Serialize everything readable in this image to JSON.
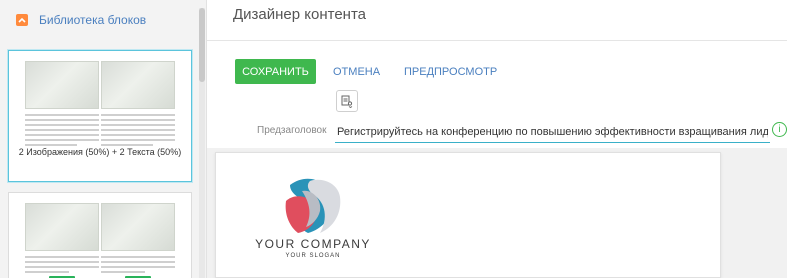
{
  "sidebar": {
    "title": "Библиотека блоков",
    "collapse_icon": "chevron-up-icon",
    "blocks": [
      {
        "label": "2 Изображения (50%) + 2 Текста (50%)",
        "selected": true
      },
      {
        "label": "",
        "selected": false
      }
    ]
  },
  "header": {
    "title": "Дизайнер контента"
  },
  "toolbar": {
    "save_label": "СОХРАНИТЬ",
    "cancel_label": "ОТМЕНА",
    "preview_label": "ПРЕДПРОСМОТР",
    "settings_icon": "page-settings-icon"
  },
  "preheader": {
    "label": "Предзаголовок",
    "value": "Регистрируйтесь на конференцию по повышению эффективности взращивания лидов",
    "info_icon": "info-icon"
  },
  "email": {
    "company": "YOUR COMPANY",
    "slogan": "YOUR SLOGAN"
  },
  "colors": {
    "accent_blue": "#4a7fbf",
    "save_green": "#3fb84e",
    "collapse_orange": "#ff8a3c",
    "input_underline": "#3ab0c8"
  }
}
